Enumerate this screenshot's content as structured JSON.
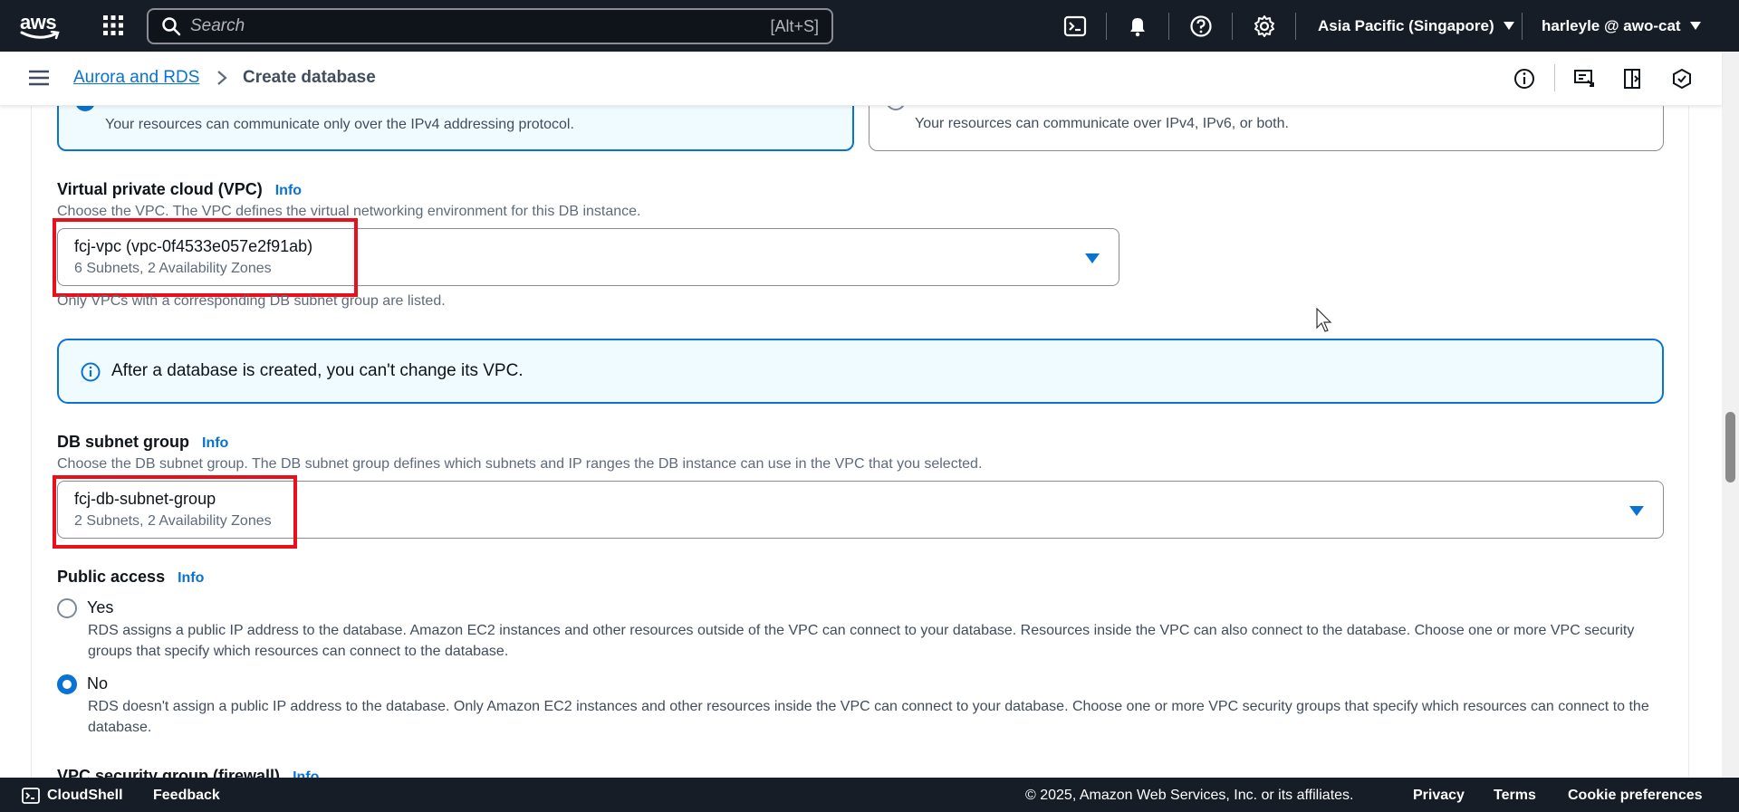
{
  "topnav": {
    "logo_text": "aws",
    "search_placeholder": "Search",
    "search_shortcut": "[Alt+S]",
    "region": "Asia Pacific (Singapore)",
    "user": "harleyle @ awo-cat",
    "icons": [
      "apps-grid-icon",
      "search-icon",
      "cloudshell-icon",
      "bell-icon",
      "help-icon",
      "gear-icon"
    ]
  },
  "breadcrumb": {
    "parent": "Aurora and RDS",
    "current": "Create database",
    "icons": [
      "info-circle-icon",
      "feedback-icon",
      "notes-icon",
      "settings-hex-icon"
    ]
  },
  "network_type": {
    "ipv4_desc": "Your resources can communicate only over the IPv4 addressing protocol.",
    "dual_desc": "Your resources can communicate over IPv4, IPv6, or both."
  },
  "vpc": {
    "label": "Virtual private cloud (VPC)",
    "info": "Info",
    "description": "Choose the VPC. The VPC defines the virtual networking environment for this DB instance.",
    "selected": "fcj-vpc (vpc-0f4533e057e2f91ab)",
    "selected_sub": "6 Subnets, 2 Availability Zones",
    "hint": "Only VPCs with a corresponding DB subnet group are listed."
  },
  "alert": {
    "text": "After a database is created, you can't change its VPC."
  },
  "subnet_group": {
    "label": "DB subnet group",
    "info": "Info",
    "description": "Choose the DB subnet group. The DB subnet group defines which subnets and IP ranges the DB instance can use in the VPC that you selected.",
    "selected": "fcj-db-subnet-group",
    "selected_sub": "2 Subnets, 2 Availability Zones"
  },
  "public_access": {
    "label": "Public access",
    "info": "Info",
    "options": [
      {
        "label": "Yes",
        "selected": false,
        "description": "RDS assigns a public IP address to the database. Amazon EC2 instances and other resources outside of the VPC can connect to your database. Resources inside the VPC can also connect to the database. Choose one or more VPC security groups that specify which resources can connect to the database."
      },
      {
        "label": "No",
        "selected": true,
        "description": "RDS doesn't assign a public IP address to the database. Only Amazon EC2 instances and other resources inside the VPC can connect to your database. Choose one or more VPC security groups that specify which resources can connect to the database."
      }
    ]
  },
  "next_section": {
    "label": "VPC security group (firewall)",
    "info": "Info"
  },
  "footer": {
    "cloudshell": "CloudShell",
    "feedback": "Feedback",
    "copyright": "© 2025, Amazon Web Services, Inc. or its affiliates.",
    "privacy": "Privacy",
    "terms": "Terms",
    "cookies": "Cookie preferences"
  },
  "colors": {
    "nav_bg": "#161d26",
    "link": "#0972d3",
    "highlight": "#e8101b",
    "alert_bg": "#f0fbff"
  }
}
